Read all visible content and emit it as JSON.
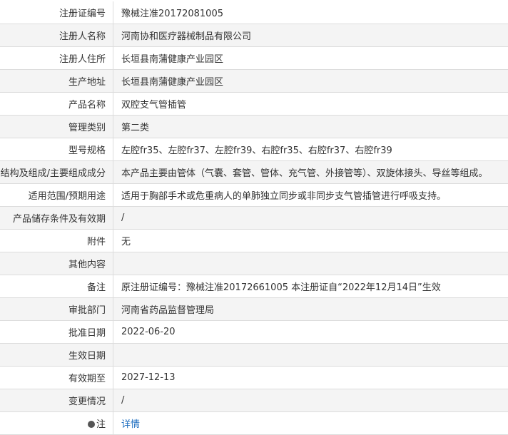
{
  "rows": [
    {
      "label": "注册证编号",
      "value": "豫械注准20172081005"
    },
    {
      "label": "注册人名称",
      "value": "河南协和医疗器械制品有限公司"
    },
    {
      "label": "注册人住所",
      "value": "长垣县南蒲健康产业园区"
    },
    {
      "label": "生产地址",
      "value": "长垣县南蒲健康产业园区"
    },
    {
      "label": "产品名称",
      "value": "双腔支气管插管"
    },
    {
      "label": "管理类别",
      "value": "第二类"
    },
    {
      "label": "型号规格",
      "value": "左腔fr35、左腔fr37、左腔fr39、右腔fr35、右腔fr37、右腔fr39"
    },
    {
      "label": "结构及组成/主要组成成分",
      "value": "本产品主要由管体（气囊、套管、管体、充气管、外接管等）、双旋体接头、导丝等组成。"
    },
    {
      "label": "适用范围/预期用途",
      "value": "适用于胸部手术或危重病人的单肺独立同步或非同步支气管插管进行呼吸支持。"
    },
    {
      "label": "产品储存条件及有效期",
      "value": "/"
    },
    {
      "label": "附件",
      "value": "无"
    },
    {
      "label": "其他内容",
      "value": ""
    },
    {
      "label": "备注",
      "value": "原注册证编号：豫械注准20172661005 本注册证自“2022年12月14日”生效"
    },
    {
      "label": "审批部门",
      "value": "河南省药品监督管理局"
    },
    {
      "label": "批准日期",
      "value": "2022-06-20"
    },
    {
      "label": "生效日期",
      "value": ""
    },
    {
      "label": "有效期至",
      "value": "2027-12-13"
    },
    {
      "label": "变更情况",
      "value": "/"
    }
  ],
  "note_row": {
    "label": "注",
    "icon": "note-icon",
    "link_text": "详情"
  }
}
